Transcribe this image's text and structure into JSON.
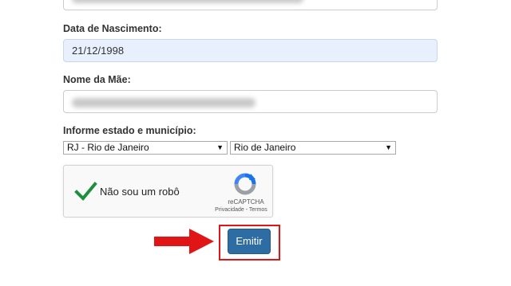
{
  "form": {
    "birth_date_label": "Data de Nascimento:",
    "birth_date_value": "21/12/1998",
    "mother_name_label": "Nome da Mãe:",
    "state_city_label": "Informe estado e município:",
    "state_selected": "RJ - Rio de Janeiro",
    "city_selected": "Rio de Janeiro",
    "submit_label": "Emitir"
  },
  "captcha": {
    "checkbox_label": "Não sou um robô",
    "brand": "reCAPTCHA",
    "privacy": "Privacidade",
    "separator": " - ",
    "terms": "Termos"
  },
  "colors": {
    "submit_button": "#2e6da4",
    "highlight_frame": "#e01616",
    "arrow": "#e01616",
    "checkmark": "#1e8e3e"
  },
  "icons": {
    "pointer_arrow": "arrow-right-icon",
    "captcha_check": "checkmark-icon",
    "captcha_logo": "recaptcha-logo-icon",
    "select_arrow": "chevron-down-icon"
  }
}
